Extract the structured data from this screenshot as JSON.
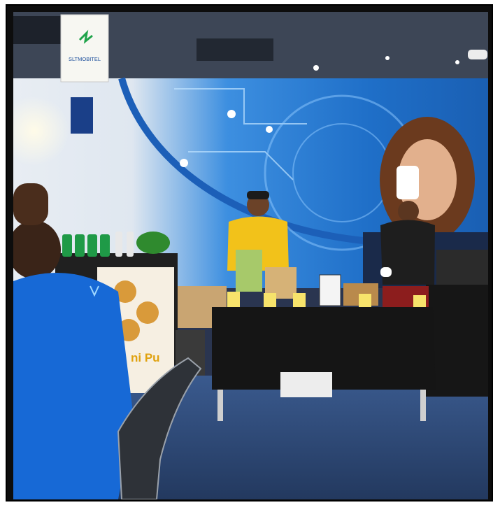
{
  "scene": {
    "type": "photo",
    "brand_sign_text": "SLTMOBITEL",
    "banner_text": "ni Pu",
    "colors": {
      "wall_blue": "#1f6fc8",
      "accent_blue": "#2b8fe0",
      "shirt_yellow": "#f2c21a",
      "polo_blue": "#1769d6",
      "carpet": "#2f4a78",
      "table_cloth": "#151515",
      "tag_yellow": "#f7e36b"
    },
    "icons": [
      "brand-logo-icon",
      "chef-hat-icon",
      "bottle-icon",
      "office-chair-icon"
    ]
  }
}
